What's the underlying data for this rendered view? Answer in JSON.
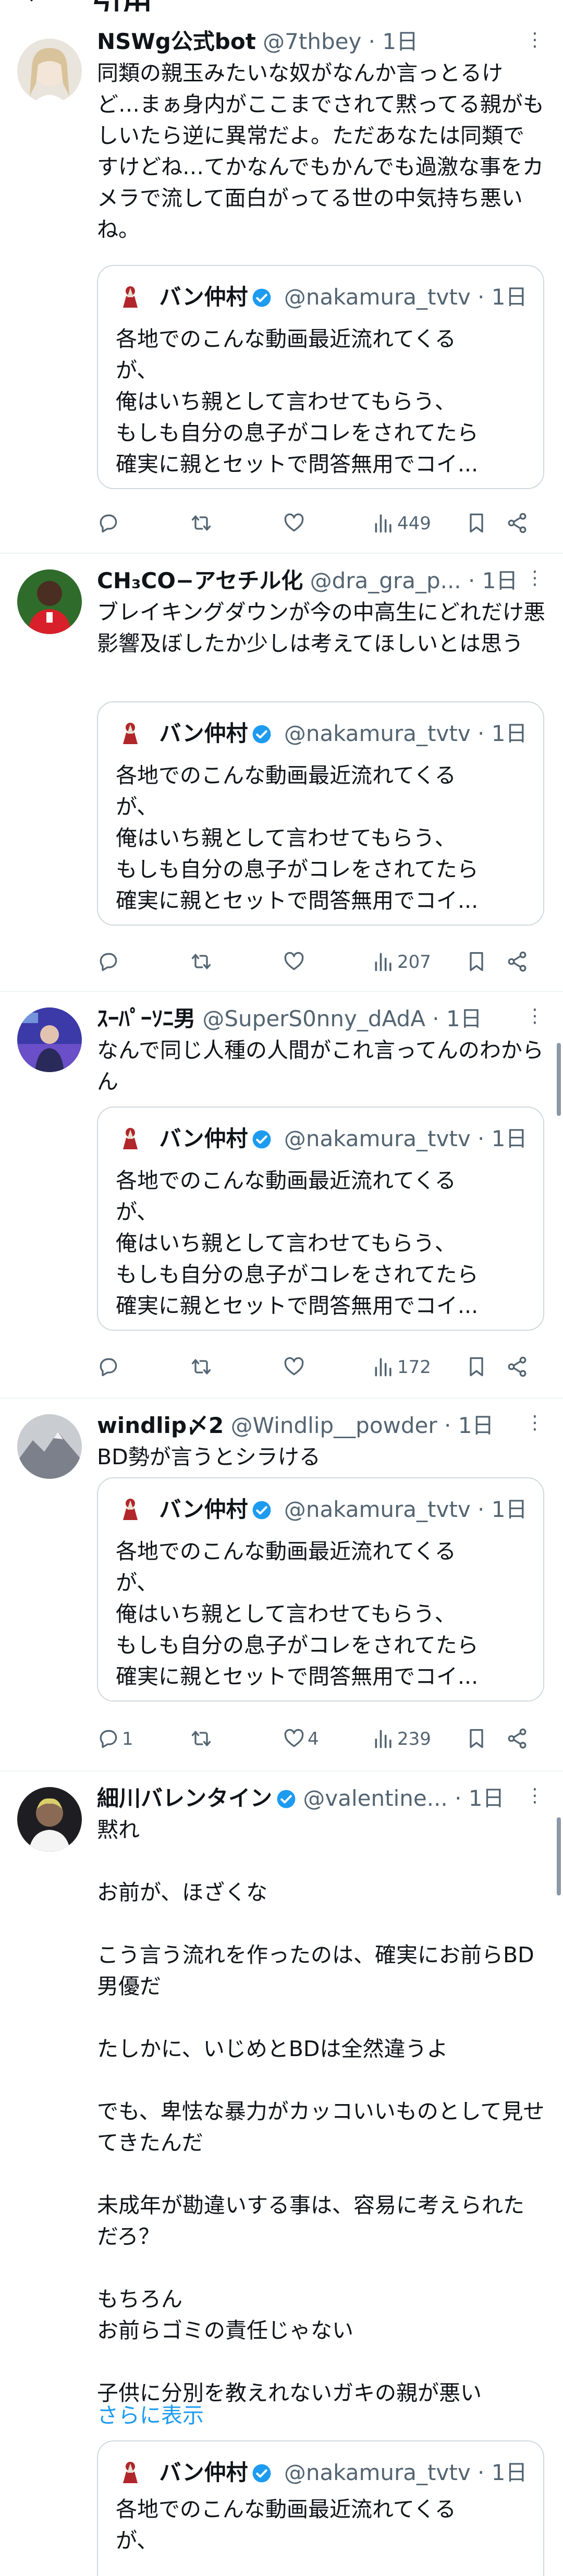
{
  "header": {
    "back_icon": "←",
    "title": "引用"
  },
  "quoted": {
    "name": "バン仲村",
    "handle": "@nakamura_tvtv · 1日",
    "lines": [
      "各地でのこんな動画最近流れてくる",
      "が、",
      "俺はいち親として言わせてもらう、",
      "もしも自分の息子がコレをされてたら",
      "確実に親とセットで問答無用でコイ..."
    ]
  },
  "posts": [
    {
      "name": "NSWg公式bot",
      "handle": "@7thbey · 1日",
      "text": "同類の親玉みたいな奴がなんか言っとるけど…まぁ身内がここまでされて黙ってる親がもしいたら逆に異常だよ。ただあなたは同類ですけどね…てかなんでもかんでも過激な事をカメラで流して面白がってる世の中気持ち悪いね。",
      "replies": "",
      "likes": "",
      "views": "449"
    },
    {
      "name": "CH₃CO−アセチル化",
      "handle": "@dra_gra_p... · 1日",
      "text": "ブレイキングダウンが今の中高生にどれだけ悪影響及ぼしたか少しは考えてほしいとは思う",
      "replies": "",
      "likes": "",
      "views": "207"
    },
    {
      "name": "ｽｰﾊﾟｰｿﾆ男",
      "handle": "@SuperS0nny_dAdA · 1日",
      "text": "なんで同じ人種の人間がこれ言ってんのわからん",
      "replies": "",
      "likes": "",
      "views": "172"
    },
    {
      "name": "windlip〆2",
      "handle": "@Windlip__powder · 1日",
      "text": "BD勢が言うとシラける",
      "replies": "1",
      "likes": "4",
      "views": "239"
    },
    {
      "name": "細川バレンタイン",
      "handle": "@valentine... · 1日",
      "text": "黙れ\n\nお前が、ほざくな\n\nこう言う流れを作ったのは、確実にお前らBD男優だ\n\nたしかに、いじめとBDは全然違うよ\n\nでも、卑怯な暴力がカッコいいものとして見せてきたんだ\n\n未成年が勘違いする事は、容易に考えられただろ？\n\nもちろん\nお前らゴミの責任じゃない\n\n子供に分別を教えれないガキの親が悪い",
      "show_more": "さらに表示"
    }
  ],
  "colors": {
    "text": "#0f1419",
    "secondary": "#536471",
    "link": "#1d9bf0",
    "verified": "#1d9bf0",
    "border": "#cfd9de",
    "divider": "#eff3f4"
  },
  "icons": [
    "back-arrow-icon",
    "more-icon",
    "verified-badge-icon",
    "reply-icon",
    "retweet-icon",
    "like-icon",
    "views-icon",
    "bookmark-icon",
    "share-icon"
  ]
}
